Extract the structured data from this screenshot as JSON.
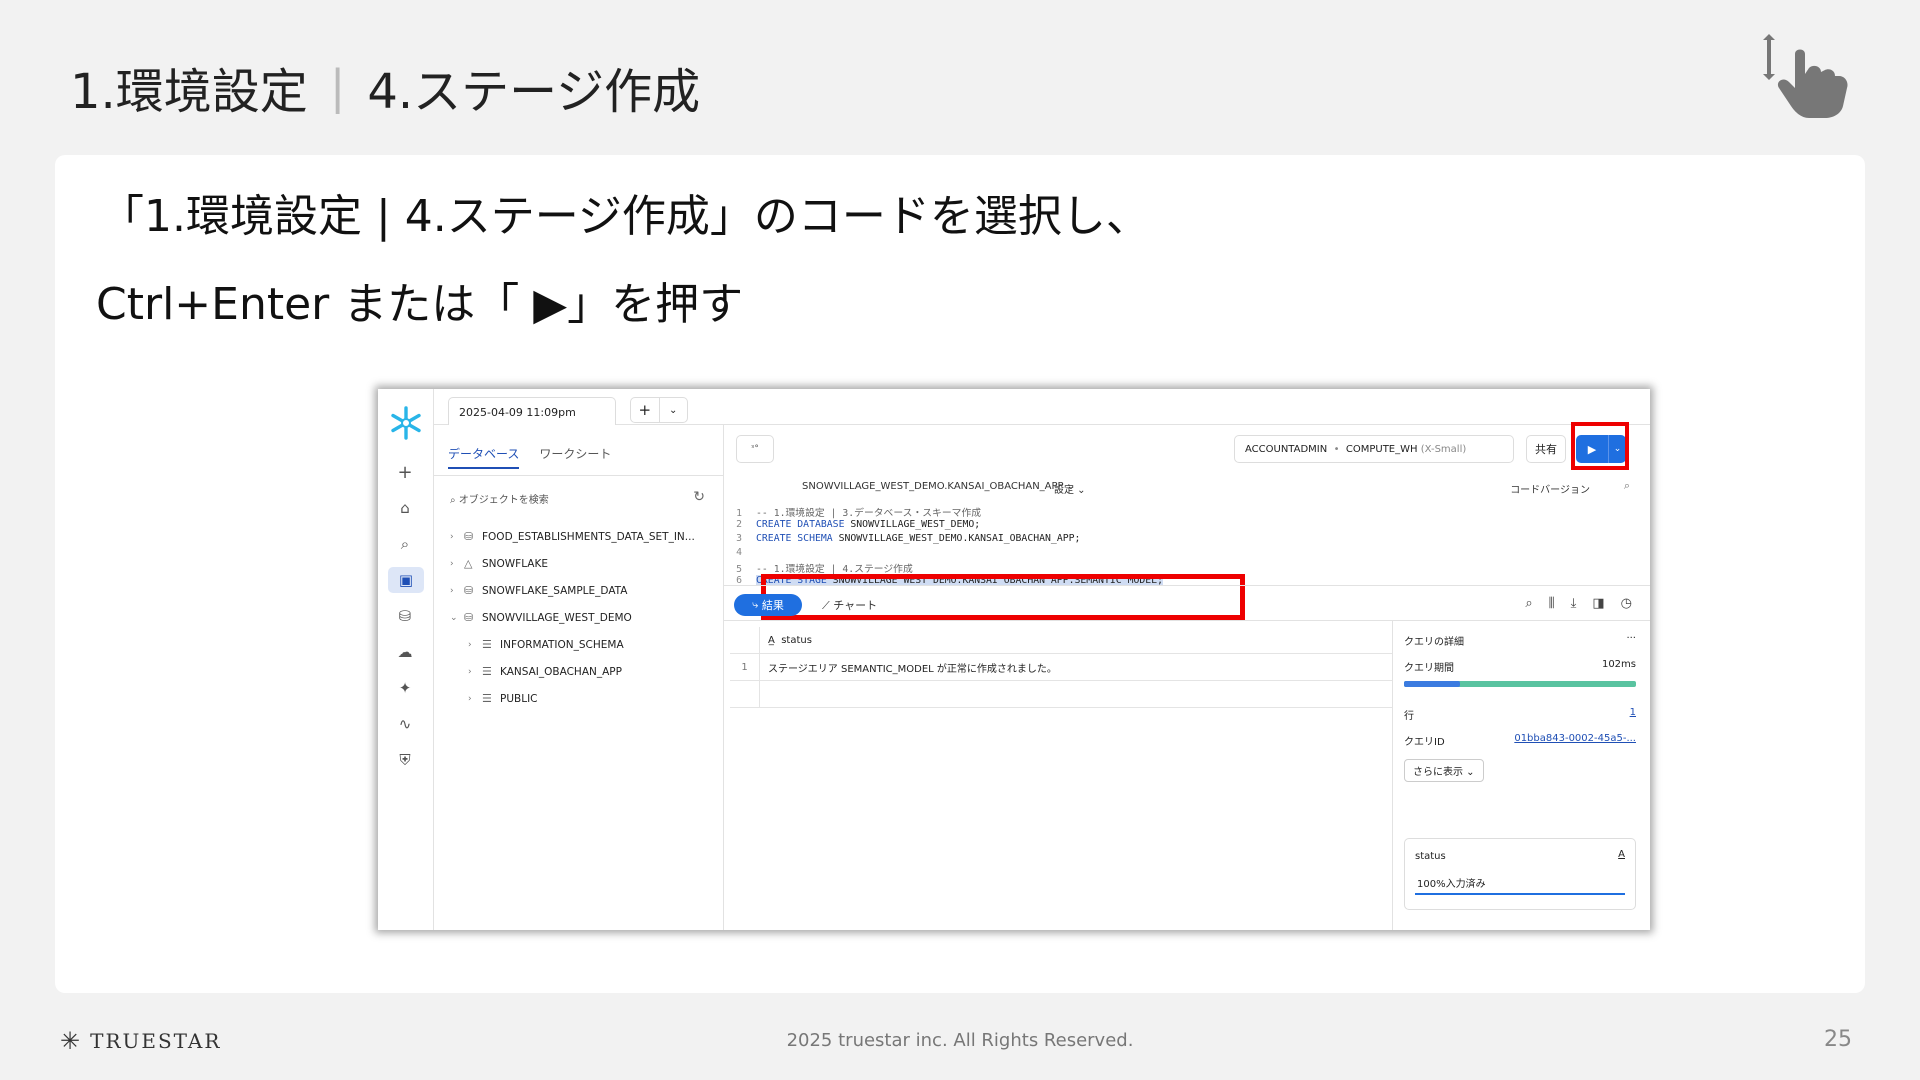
{
  "slide": {
    "title_part1": "1.環境設定",
    "title_sep": "|",
    "title_part2": "4.ステージ作成",
    "instruction_line1": "「1.環境設定 | 4.ステージ作成」のコードを選択し、",
    "instruction_line2": "Ctrl+Enter または「 ▶」を押す",
    "brand": "TRUESTAR",
    "copyright": "2025 truestar inc. All Rights Reserved.",
    "page_number": "25"
  },
  "snowsight": {
    "worksheet_tab": "2025-04-09 11:09pm",
    "new_tab": "+",
    "tab_menu": "⌄",
    "left_tabs": {
      "databases": "データベース",
      "worksheets": "ワークシート"
    },
    "search_placeholder": "オブジェクトを検索",
    "tree": [
      {
        "name": "FOOD_ESTABLISHMENTS_DATA_SET_IN...",
        "chev": "›",
        "icon": "⛁"
      },
      {
        "name": "SNOWFLAKE",
        "chev": "›",
        "icon": "△"
      },
      {
        "name": "SNOWFLAKE_SAMPLE_DATA",
        "chev": "›",
        "icon": "⛁"
      },
      {
        "name": "SNOWVILLAGE_WEST_DEMO",
        "chev": "⌄",
        "icon": "⛁"
      },
      {
        "name": "INFORMATION_SCHEMA",
        "chev": "›",
        "icon": "☰"
      },
      {
        "name": "KANSAI_OBACHAN_APP",
        "chev": "›",
        "icon": "☰"
      },
      {
        "name": "PUBLIC",
        "chev": "›",
        "icon": "☰"
      }
    ],
    "toolbar": {
      "role": "ACCOUNTADMIN",
      "dot": "•",
      "warehouse": "COMPUTE_WH",
      "warehouse_size": "(X-Small)",
      "share_label": "共有",
      "run_label": "▶",
      "run_menu": "⌄"
    },
    "path": {
      "database": "SNOWVILLAGE_WEST_DEMO.KANSAI_OBACHAN_APP  ⌄",
      "settings": "設定  ⌄",
      "versions": "コードバージョン"
    },
    "code_lines": [
      {
        "n": "1",
        "text": "-- 1.環境設定 | 3.データベース・スキーマ作成"
      },
      {
        "n": "2",
        "kw": "CREATE DATABASE",
        "text": " SNOWVILLAGE_WEST_DEMO;"
      },
      {
        "n": "3",
        "kw": "CREATE SCHEMA",
        "text": " SNOWVILLAGE_WEST_DEMO.KANSAI_OBACHAN_APP;"
      },
      {
        "n": "4",
        "text": ""
      },
      {
        "n": "5",
        "text": "-- 1.環境設定 | 4.ステージ作成"
      },
      {
        "n": "6",
        "kw": "CREATE STAGE",
        "text": " SNOWVILLAGE_WEST_DEMO.KANSAI_OBACHAN_APP.SEMANTIC_MODEL;"
      }
    ],
    "results_tab": "結果",
    "chart_tab": "チャート",
    "grid": {
      "header": "status",
      "rows": [
        {
          "n": "1",
          "status": "ステージエリア SEMANTIC_MODEL が正常に作成されました。"
        }
      ]
    },
    "details": {
      "title": "クエリの詳細",
      "menu": "···",
      "duration_label": "クエリ期間",
      "duration_value": "102ms",
      "duration_split": 0.24,
      "rows_label": "行",
      "rows_value": "1",
      "query_id_label": "クエリID",
      "query_id_value": "01bba843-0002-45a5-...",
      "show_more": "さらに表示 ⌄",
      "status_label": "status",
      "status_type": "A",
      "status_value": "100%入力済み"
    }
  }
}
